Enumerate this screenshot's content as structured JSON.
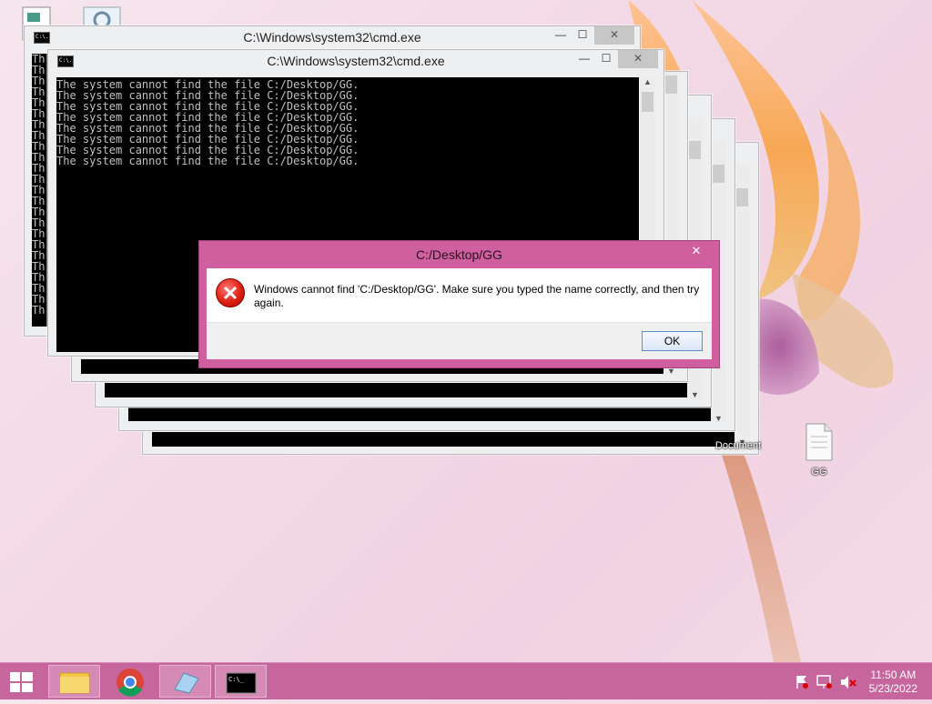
{
  "cmd_windows": [
    {
      "title": "C:\\Windows\\system32\\cmd.exe",
      "icon_text": "C:\\."
    },
    {
      "title": "C:\\Windows\\system32\\cmd.exe",
      "icon_text": "C:\\."
    }
  ],
  "console_lines": [
    "The system cannot find the file C:/Desktop/GG.",
    "The system cannot find the file C:/Desktop/GG.",
    "The system cannot find the file C:/Desktop/GG.",
    "The system cannot find the file C:/Desktop/GG.",
    "The system cannot find the file C:/Desktop/GG.",
    "The system cannot find the file C:/Desktop/GG.",
    "The system cannot find the file C:/Desktop/GG.",
    "The system cannot find the file C:/Desktop/GG."
  ],
  "back_console_prefix": "Th",
  "back_console_rows": 24,
  "dialog": {
    "title": "C:/Desktop/GG",
    "close": "✕",
    "message": "Windows cannot find 'C:/Desktop/GG'. Make sure you typed the name correctly, and then try again.",
    "ok_label": "OK"
  },
  "desktop_icons": [
    {
      "label": "Document"
    },
    {
      "label": "GG"
    }
  ],
  "taskbar": {
    "items": [
      "start-button",
      "file-explorer",
      "chrome",
      "notepad",
      "cmd"
    ],
    "clock_time": "11:50 AM",
    "clock_date": "5/23/2022"
  },
  "colors": {
    "accent": "#c7659d",
    "dialog_border": "#cf5f9f",
    "console_bg": "#000000",
    "console_fg": "#c0c0c0"
  }
}
